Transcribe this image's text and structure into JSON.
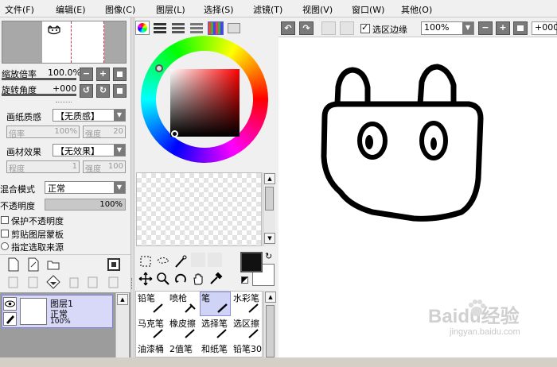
{
  "menu": [
    "文件(F)",
    "编辑(E)",
    "图像(C)",
    "图层(L)",
    "选择(S)",
    "滤镜(T)",
    "视图(V)",
    "窗口(W)",
    "其他(O)"
  ],
  "navigator": {
    "zoom_label": "缩放倍率",
    "zoom_value": "100.0%",
    "rotate_label": "旋转角度",
    "rotate_value": "+000"
  },
  "paper": {
    "texture_label": "画纸质感",
    "texture_value": "【无质感】",
    "texture_scale_label": "倍率",
    "texture_scale_value": "100%",
    "texture_strength_label": "强度",
    "texture_strength_value": "20",
    "effect_label": "画材效果",
    "effect_value": "【无效果】",
    "effect_degree_label": "程度",
    "effect_degree_value": "1",
    "effect_strength_label": "强度",
    "effect_strength_value": "100"
  },
  "layer_props": {
    "blend_label": "混合模式",
    "blend_value": "正常",
    "opacity_label": "不透明度",
    "opacity_value": "100%",
    "protect_opacity": "保护不透明度",
    "clipping": "剪贴图层蒙板",
    "selection_source": "指定选取来源"
  },
  "layer": {
    "name": "图层1",
    "mode": "正常",
    "opacity": "100%"
  },
  "tools": [
    [
      "铅笔",
      "喷枪",
      "笔",
      "水彩笔"
    ],
    [
      "马克笔",
      "橡皮擦",
      "选择笔",
      "选区擦"
    ],
    [
      "油漆桶",
      "2值笔",
      "和纸笔",
      "铅笔30"
    ]
  ],
  "selected_tool": "笔",
  "toolbar": {
    "show_selection": "选区边缘",
    "zoom": "100%",
    "rotate": "+000"
  },
  "colors": {
    "accent_selected": "#cfd4f7",
    "foreground": "#111111",
    "background": "#ffffff"
  },
  "watermark": {
    "text": "Baidu经验",
    "url": "jingyan.baidu.com"
  }
}
